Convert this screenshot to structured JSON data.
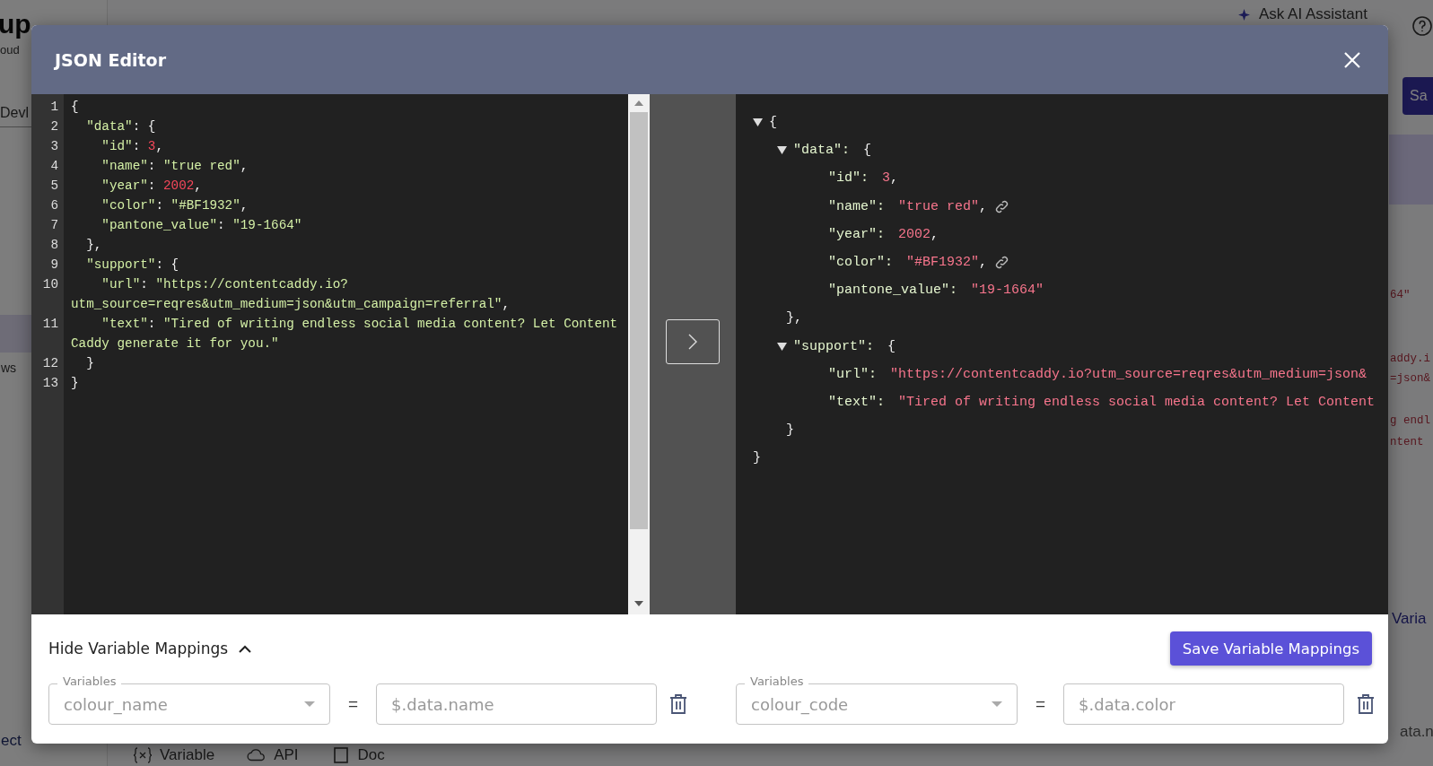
{
  "background": {
    "brand": "up",
    "brand_sub": "oud",
    "tab": "Devl",
    "nav_item": "ws",
    "footer_link": "ect",
    "assistant": "Ask AI Assistant",
    "save_button": "Sa",
    "code_fragments": [
      "64\"",
      "addy.i",
      "=json&",
      "g endl",
      "ntent"
    ],
    "link_fragment": "Varia",
    "field_fragment": "ata.n",
    "toolbar": [
      {
        "kind": "variable",
        "label": "Variable"
      },
      {
        "kind": "api",
        "label": "API"
      },
      {
        "kind": "doc",
        "label": "Doc"
      }
    ]
  },
  "modal": {
    "title": "JSON Editor",
    "editor": {
      "lines": [
        {
          "number": "1",
          "tokens": [
            {
              "kind": "punct",
              "text": "{"
            }
          ]
        },
        {
          "number": "2",
          "tokens": [
            {
              "kind": "key",
              "text": "  \"data\""
            },
            {
              "kind": "punct",
              "text": ": {"
            }
          ]
        },
        {
          "number": "3",
          "tokens": [
            {
              "kind": "key",
              "text": "    \"id\""
            },
            {
              "kind": "punct",
              "text": ": "
            },
            {
              "kind": "number",
              "text": "3"
            },
            {
              "kind": "punct",
              "text": ","
            }
          ]
        },
        {
          "number": "4",
          "tokens": [
            {
              "kind": "key",
              "text": "    \"name\""
            },
            {
              "kind": "punct",
              "text": ": "
            },
            {
              "kind": "string",
              "text": "\"true red\""
            },
            {
              "kind": "punct",
              "text": ","
            }
          ]
        },
        {
          "number": "5",
          "tokens": [
            {
              "kind": "key",
              "text": "    \"year\""
            },
            {
              "kind": "punct",
              "text": ": "
            },
            {
              "kind": "number",
              "text": "2002"
            },
            {
              "kind": "punct",
              "text": ","
            }
          ]
        },
        {
          "number": "6",
          "tokens": [
            {
              "kind": "key",
              "text": "    \"color\""
            },
            {
              "kind": "punct",
              "text": ": "
            },
            {
              "kind": "string",
              "text": "\"#BF1932\""
            },
            {
              "kind": "punct",
              "text": ","
            }
          ]
        },
        {
          "number": "7",
          "tokens": [
            {
              "kind": "key",
              "text": "    \"pantone_value\""
            },
            {
              "kind": "punct",
              "text": ": "
            },
            {
              "kind": "string",
              "text": "\"19-1664\""
            }
          ]
        },
        {
          "number": "8",
          "tokens": [
            {
              "kind": "punct",
              "text": "  },"
            }
          ]
        },
        {
          "number": "9",
          "tokens": [
            {
              "kind": "key",
              "text": "  \"support\""
            },
            {
              "kind": "punct",
              "text": ": {"
            }
          ]
        },
        {
          "number": "10",
          "tokens": [
            {
              "kind": "key",
              "text": "    \"url\""
            },
            {
              "kind": "punct",
              "text": ": "
            },
            {
              "kind": "string",
              "text": "\"https://contentcaddy.io?utm_source=reqres&utm_medium=json&utm_campaign=referral\""
            },
            {
              "kind": "punct",
              "text": ","
            }
          ]
        },
        {
          "number": "11",
          "tokens": [
            {
              "kind": "key",
              "text": "    \"text\""
            },
            {
              "kind": "punct",
              "text": ": "
            },
            {
              "kind": "string",
              "text": "\"Tired of writing endless social media content? Let Content Caddy generate it for you.\""
            }
          ]
        },
        {
          "number": "12",
          "tokens": [
            {
              "kind": "punct",
              "text": "  }"
            }
          ]
        },
        {
          "number": "13",
          "tokens": [
            {
              "kind": "punct",
              "text": "}"
            }
          ]
        }
      ]
    },
    "viewer": {
      "open": "{",
      "close": "}",
      "expanded": true,
      "groups": [
        {
          "key": "\"data\":",
          "open": "{",
          "close": "},",
          "expanded": true,
          "items": [
            {
              "key": "\"id\":",
              "value": "3",
              "sep": ",",
              "linked": false
            },
            {
              "key": "\"name\":",
              "value": "\"true red\"",
              "sep": ",",
              "linked": true
            },
            {
              "key": "\"year\":",
              "value": "2002",
              "sep": ",",
              "linked": false
            },
            {
              "key": "\"color\":",
              "value": "\"#BF1932\"",
              "sep": ",",
              "linked": true
            },
            {
              "key": "\"pantone_value\":",
              "value": "\"19-1664\"",
              "linked": false
            }
          ]
        },
        {
          "key": "\"support\":",
          "open": "{",
          "close": "}",
          "expanded": true,
          "items": [
            {
              "key": "\"url\":",
              "value": "\"https://contentcaddy.io?utm_source=reqres&utm_medium=json&",
              "linked": false
            },
            {
              "key": "\"text\":",
              "value": "\"Tired of writing endless social media content? Let Content",
              "linked": false
            }
          ]
        }
      ]
    },
    "mappings_toggle": {
      "label": "Hide Variable Mappings",
      "expanded": true
    },
    "save_button": "Save Variable Mappings",
    "mappings": [
      {
        "label": "Variables",
        "variable": "colour_name",
        "equals": "=",
        "path": "$.data.name"
      },
      {
        "label": "Variables",
        "variable": "colour_code",
        "equals": "=",
        "path": "$.data.color"
      }
    ]
  }
}
